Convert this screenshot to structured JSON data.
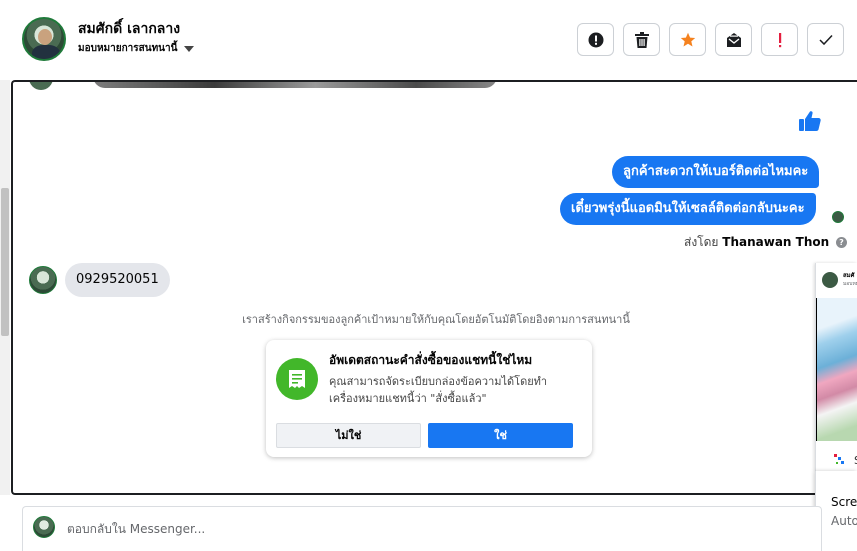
{
  "header": {
    "user_name": "สมศักดิ์ เลากลาง",
    "assign_label": "มอบหมายการสนทนานี้"
  },
  "toolbar": {
    "buttons": [
      {
        "icon": "alert-circle-icon"
      },
      {
        "icon": "trash-icon"
      },
      {
        "icon": "star-icon",
        "color": "#f5821f"
      },
      {
        "icon": "mark-unread-icon"
      },
      {
        "icon": "exclamation-icon",
        "color": "#e41e3f"
      },
      {
        "icon": "check-icon"
      }
    ]
  },
  "messages": {
    "outgoing": [
      "ลูกค้าสะดวกให้เบอร์ติดต่อไหมคะ",
      "เดี๋ยวพรุ่งนี้แอดมินให้เซลล์ติดต่อกลับนะคะ"
    ],
    "sent_by_prefix": "ส่งโดย",
    "sent_by_name": "Thanawan Thon",
    "incoming": "0929520051",
    "system_note": "เราสร้างกิจกรรมของลูกค้าเป้าหมายให้กับคุณโดยอัตโนมัติโดยอิงตามการสนทนานี้"
  },
  "order_card": {
    "title": "อัพเดตสถานะคำสั่งซื้อของแชทนี้ใช่ไหม",
    "description": "คุณสามารถจัดระเบียบกล่องข้อความได้โดยทำเครื่องหมายแชทนี้ว่า \"สั่งซื้อแล้ว\"",
    "no_label": "ไม่ใช่",
    "yes_label": "ใช่"
  },
  "side_panel": {
    "name": "สมศั",
    "sub": "มอบหม"
  },
  "toast": {
    "label_s": "S",
    "line1": "Scre",
    "line2": "Auto"
  },
  "composer": {
    "placeholder": "ตอบกลับใน Messenger..."
  },
  "colors": {
    "brand_blue": "#1877f2",
    "green": "#42b72a",
    "incoming_bg": "#e4e6eb"
  }
}
